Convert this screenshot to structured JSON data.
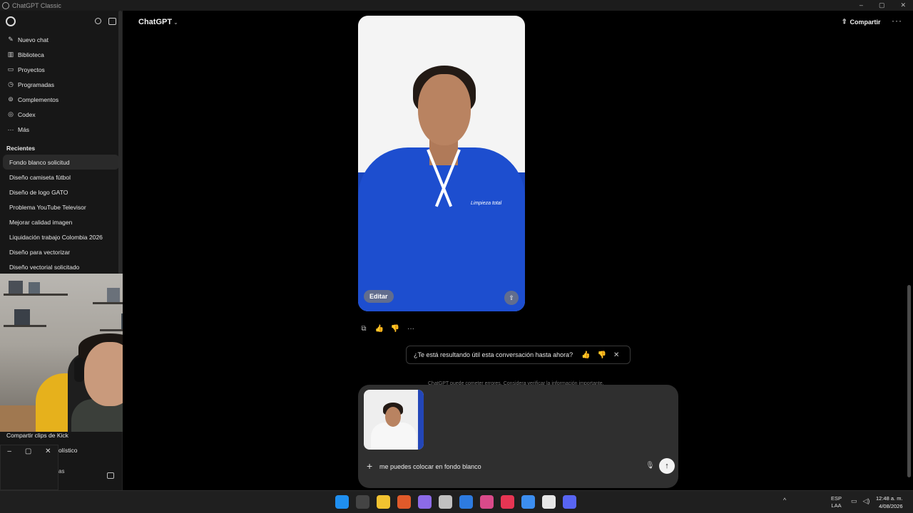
{
  "window": {
    "title": "ChatGPT Classic",
    "controls": [
      "–",
      "▢",
      "✕"
    ]
  },
  "sidebar": {
    "nav": [
      {
        "label": "Nuevo chat",
        "icon": "edit-icon",
        "glyph": "✎"
      },
      {
        "label": "Biblioteca",
        "icon": "library-icon",
        "glyph": "▥"
      },
      {
        "label": "Proyectos",
        "icon": "folder-icon",
        "glyph": "▭"
      },
      {
        "label": "Programadas",
        "icon": "clock-icon",
        "glyph": "◷"
      },
      {
        "label": "Complementos",
        "icon": "plugin-icon",
        "glyph": "⊚"
      },
      {
        "label": "Codex",
        "icon": "codex-icon",
        "glyph": "◎"
      },
      {
        "label": "Más",
        "icon": "more-icon",
        "glyph": "···"
      }
    ],
    "recent_heading": "Recientes",
    "recent": [
      "Fondo blanco solicitud",
      "Diseño camiseta fútbol",
      "Diseño de logo GATO",
      "Problema YouTube Televisor",
      "Mejorar calidad imagen",
      "Liquidación trabajo Colombia 2026",
      "Diseño para vectorizar",
      "Diseño vectorial solicitado"
    ],
    "partial_below": "Compartir clips de Kick",
    "partial_right_1": "olístico",
    "partial_right_2": "as"
  },
  "mini_window": {
    "controls": [
      "–",
      "▢",
      "✕"
    ]
  },
  "header": {
    "model": "ChatGPT",
    "model_chevron": "⌄",
    "share": "Compartir",
    "more": "···"
  },
  "image_card": {
    "edit": "Editar",
    "share_glyph": "⇧",
    "logo_text": "Limpieza total"
  },
  "message_actions": {
    "copy": "⧉",
    "thumbs_up": "👍",
    "thumbs_down": "👎",
    "more": "···"
  },
  "feedback": {
    "question": "¿Te está resultando útil esta conversación hasta ahora?",
    "up": "👍",
    "down": "👎",
    "close": "✕"
  },
  "disclaimer": "ChatGPT puede cometer errores. Considera verificar la información importante.",
  "composer": {
    "value": "me puedes colocar en fondo blanco",
    "plus": "+",
    "mic": "🎙",
    "send": "↑"
  },
  "taskbar": {
    "lang_top": "ESP",
    "lang_bottom": "LAA",
    "time": "12:48 a. m.",
    "date": "4/08/2026",
    "tray_up": "^",
    "app_colors": [
      "#1f8ff0",
      "#444",
      "#f2c230",
      "#e05a2a",
      "#8c6be8",
      "#c0c0c0",
      "#2d7be0",
      "#d94a8a",
      "#e63553",
      "#3c8ef0",
      "#e6e6e6",
      "#5865f2"
    ]
  }
}
